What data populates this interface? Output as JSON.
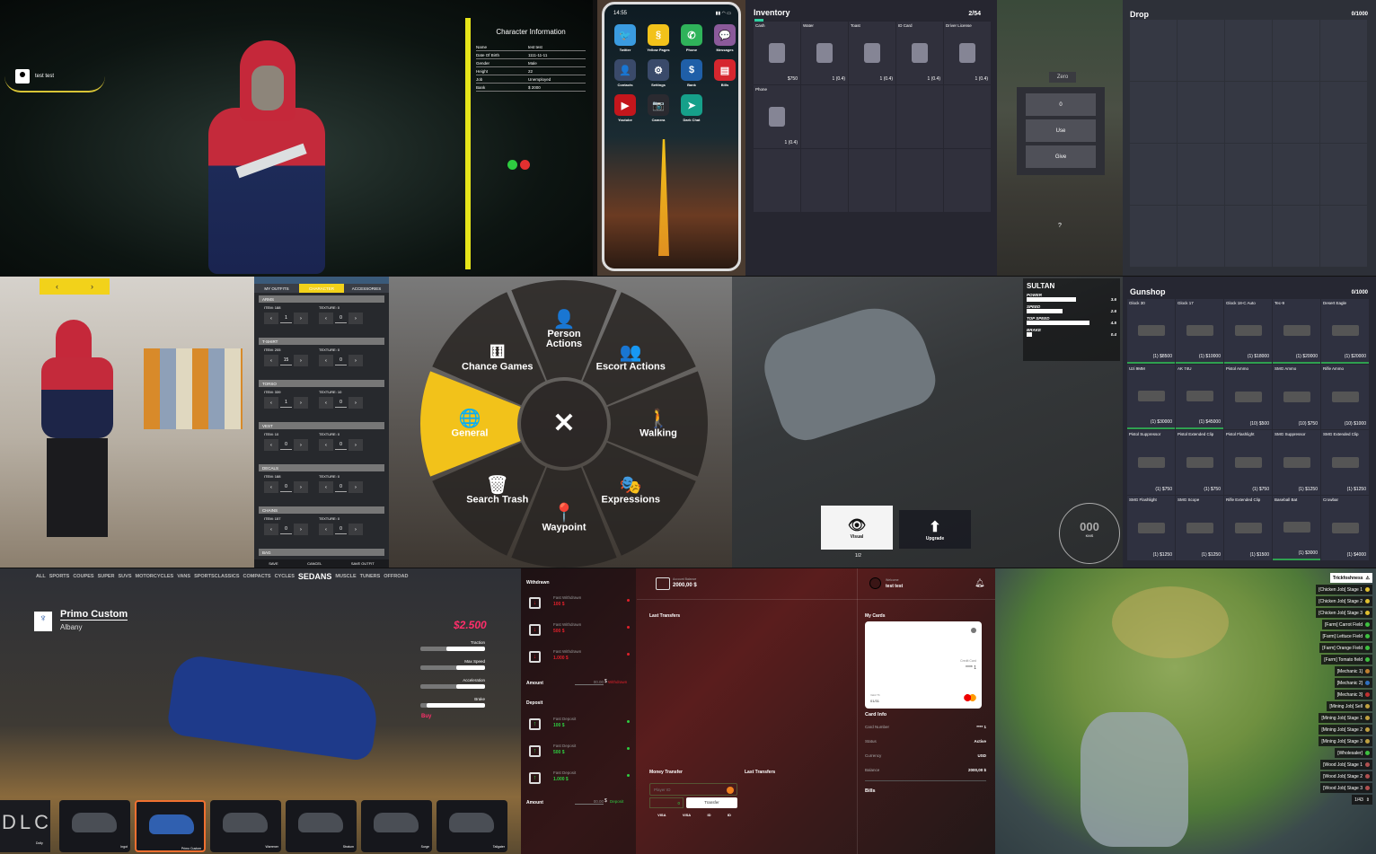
{
  "character_info": {
    "user_tag": "test test",
    "title": "Character Information",
    "rows": [
      {
        "label": "Name",
        "value": "test test"
      },
      {
        "label": "Date Of Birth",
        "value": "1111-11-11"
      },
      {
        "label": "Gender",
        "value": "Male"
      },
      {
        "label": "Height",
        "value": "22"
      },
      {
        "label": "Job",
        "value": "Unemployed"
      },
      {
        "label": "Bank",
        "value": "$ 2000"
      }
    ],
    "accent": "#e6e51a"
  },
  "phone": {
    "time": "14:55",
    "apps": [
      {
        "label": "Twitter",
        "icon": "twitter-icon",
        "color": "#3a9be0",
        "glyph": "🐦"
      },
      {
        "label": "Yellow Pages",
        "icon": "yellow-pages-icon",
        "color": "#f2c21a",
        "glyph": "§"
      },
      {
        "label": "Phone",
        "icon": "phone-icon",
        "color": "#2fb35a",
        "glyph": "✆"
      },
      {
        "label": "Messages",
        "icon": "messages-icon",
        "color": "#8a5a9a",
        "glyph": "💬"
      },
      {
        "label": "Contacts",
        "icon": "contacts-icon",
        "color": "#3a4a6a",
        "glyph": "👤"
      },
      {
        "label": "Settings",
        "icon": "settings-icon",
        "color": "#3a4a6a",
        "glyph": "⚙"
      },
      {
        "label": "Bank",
        "icon": "bank-icon",
        "color": "#1f5fa8",
        "glyph": "$"
      },
      {
        "label": "Bills",
        "icon": "bills-icon",
        "color": "#d6262e",
        "glyph": "▤"
      },
      {
        "label": "Youtube",
        "icon": "youtube-icon",
        "color": "#c4161c",
        "glyph": "▶"
      },
      {
        "label": "Camera",
        "icon": "camera-icon",
        "color": "#2a2a30",
        "glyph": "📷"
      },
      {
        "label": "Dark Chat",
        "icon": "dark-chat-icon",
        "color": "#16a08a",
        "glyph": "➤"
      }
    ]
  },
  "inventory": {
    "title": "Inventory",
    "count": "2/54",
    "items": [
      {
        "label": "Cash",
        "qty": "$750",
        "icon": "cash-icon"
      },
      {
        "label": "Water",
        "qty": "1 (0.4)",
        "icon": "water-bottle-icon"
      },
      {
        "label": "Toast",
        "qty": "1 (0.4)",
        "icon": "toast-icon"
      },
      {
        "label": "ID Card",
        "qty": "1 (0.4)",
        "icon": "id-card-icon"
      },
      {
        "label": "Driver License",
        "qty": "1 (0.4)",
        "icon": "driver-license-icon"
      },
      {
        "label": "Phone",
        "qty": "1 (0.4)",
        "icon": "phone-item-icon"
      }
    ],
    "accent": "#2fd0a0"
  },
  "item_menu": {
    "title": "Zero",
    "amount": "0",
    "use": "Use",
    "give": "Give",
    "help": "?"
  },
  "drop": {
    "title": "Drop",
    "count": "0/1000"
  },
  "clothing": {
    "tabs": [
      "MY OUTFITS",
      "CHARACTER",
      "ACCESSORIES"
    ],
    "active_tab": "CHARACTER",
    "sections": [
      {
        "name": "ARMS",
        "item_label": "ITEM: 188",
        "item_value": "1",
        "texture_label": "TEXTURE: 0",
        "texture_value": "0"
      },
      {
        "name": "T-SHIRT",
        "item_label": "ITEM: 205",
        "item_value": "15",
        "texture_label": "TEXTURE: 0",
        "texture_value": "0"
      },
      {
        "name": "TORSO",
        "item_label": "ITEM: 339",
        "item_value": "1",
        "texture_label": "TEXTURE: 10",
        "texture_value": "0"
      },
      {
        "name": "VEST",
        "item_label": "ITEM: 10",
        "item_value": "0",
        "texture_label": "TEXTURE: 0",
        "texture_value": "0"
      },
      {
        "name": "DECALS",
        "item_label": "ITEM: 188",
        "item_value": "0",
        "texture_label": "TEXTURE: 0",
        "texture_value": "0"
      },
      {
        "name": "CHAINS",
        "item_label": "ITEM: 157",
        "item_value": "0",
        "texture_label": "TEXTURE: 0",
        "texture_value": "0"
      },
      {
        "name": "BAG",
        "item_label": "ITEM: 88",
        "item_value": "0",
        "texture_label": "TEXTURE: 0",
        "texture_value": "0"
      }
    ],
    "footer": {
      "save": "SAVE",
      "cancel": "CANCEL",
      "save_outfit": "SAVE OUTFIT"
    },
    "accent": "#f2d21a"
  },
  "radial_menu": {
    "items": [
      {
        "label": "Person Actions",
        "icon": "person-icon",
        "glyph": "👤"
      },
      {
        "label": "Escort Actions",
        "icon": "escort-icon",
        "glyph": "👥"
      },
      {
        "label": "Walking",
        "icon": "walking-icon",
        "glyph": "🚶"
      },
      {
        "label": "Expressions",
        "icon": "expressions-icon",
        "glyph": "🎭"
      },
      {
        "label": "Waypoint",
        "icon": "waypoint-icon",
        "glyph": "📍"
      },
      {
        "label": "Search Trash",
        "icon": "trash-icon",
        "glyph": "🗑"
      },
      {
        "label": "General",
        "icon": "globe-icon",
        "glyph": "🌐",
        "active": true
      },
      {
        "label": "Chance Games",
        "icon": "dice-icon",
        "glyph": "⚅"
      }
    ],
    "close_glyph": "✕",
    "accent": "#f2c21a"
  },
  "vehicle_stats": {
    "name": "SULTAN",
    "stats": [
      {
        "label": "POWER",
        "value": "3.6",
        "fill": 0.55
      },
      {
        "label": "SPEED",
        "value": "2.6",
        "fill": 0.4
      },
      {
        "label": "TOP SPEED",
        "value": "4.5",
        "fill": 0.7
      },
      {
        "label": "BRAKE",
        "value": "0.4",
        "fill": 0.06
      }
    ],
    "buttons": [
      {
        "label": "Visual",
        "icon": "eye-icon"
      },
      {
        "label": "Upgrade",
        "icon": "arrow-up-icon"
      }
    ],
    "page": "1/2",
    "speed": "000",
    "speed_unit": "KMS"
  },
  "gunshop": {
    "title": "Gunshop",
    "count": "0/1000",
    "items": [
      {
        "label": "Glock 30",
        "price": "(1) $8500"
      },
      {
        "label": "Glock 17",
        "price": "(1) $10000"
      },
      {
        "label": "Glock 18-C Auto",
        "price": "(1) $18000"
      },
      {
        "label": "Tec-9",
        "price": "(1) $20000"
      },
      {
        "label": "Desert Eagle",
        "price": "(1) $20000"
      },
      {
        "label": "Uzi 9MM",
        "price": "(1) $30000"
      },
      {
        "label": "AK 74U",
        "price": "(1) $45000"
      },
      {
        "label": "Pistol Ammo",
        "price": "(10) $500"
      },
      {
        "label": "SMG Ammo",
        "price": "(10) $750"
      },
      {
        "label": "Rifle Ammo",
        "price": "(10) $1000"
      },
      {
        "label": "Pistol Suppressor",
        "price": "(1) $750"
      },
      {
        "label": "Pistol Extended Clip",
        "price": "(1) $750"
      },
      {
        "label": "Pistol Flashlight",
        "price": "(1) $750"
      },
      {
        "label": "SMG Suppressor",
        "price": "(1) $1250"
      },
      {
        "label": "SMG Extended Clip",
        "price": "(1) $1250"
      },
      {
        "label": "SMG Flashlight",
        "price": "(1) $1250"
      },
      {
        "label": "SMG Scope",
        "price": "(1) $1250"
      },
      {
        "label": "Rifle Extended Clip",
        "price": "(1) $1500"
      },
      {
        "label": "Baseball Bat",
        "price": "(1) $3000"
      },
      {
        "label": "Crowbar",
        "price": "(1) $4000"
      }
    ]
  },
  "vehicle_shop": {
    "categories": [
      "ALL",
      "SPORTS",
      "COUPES",
      "SUPER",
      "SUVS",
      "MOTORCYCLES",
      "VANS",
      "SPORTSCLASSICS",
      "COMPACTS",
      "CYCLES",
      "SEDANS",
      "MUSCLE",
      "TUNERS",
      "OFFROAD"
    ],
    "active_category": "SEDANS",
    "vehicle_name": "Primo Custom",
    "brand": "Albany",
    "price": "$2.500",
    "stats": [
      {
        "label": "Traction",
        "fill": 0.6
      },
      {
        "label": "Max Speed",
        "fill": 0.45
      },
      {
        "label": "Acceleration",
        "fill": 0.45
      },
      {
        "label": "Brake",
        "fill": 0.9
      }
    ],
    "buy": "Buy",
    "logo": "DLC",
    "cars": [
      "Dolly",
      "Ingot",
      "Primo Custom",
      "Warrener",
      "Stratum",
      "Surge",
      "Tailgater"
    ],
    "selected_car": "Primo Custom",
    "accent": "#ff2e6a"
  },
  "bank": {
    "withdrawn_title": "Withdrawn",
    "withdrawals": [
      {
        "label": "Fast Withdrawn",
        "value": "100 $"
      },
      {
        "label": "Fast Withdrawn",
        "value": "500 $"
      },
      {
        "label": "Fast Withdrawn",
        "value": "1.000 $"
      }
    ],
    "amount_label": "Amount",
    "amount_placeholder": "00.00",
    "currency": "$",
    "withdrawn_button": "Withdrawn",
    "deposit_title": "Deposit",
    "deposits": [
      {
        "label": "Fast Deposit",
        "value": "100 $"
      },
      {
        "label": "Fast Deposit",
        "value": "500 $"
      },
      {
        "label": "Fast Deposit",
        "value": "1.000 $"
      }
    ],
    "deposit_button": "Deposit",
    "balance_label": "Account Balance",
    "balance": "2000,00 $",
    "welcome": "Welcome",
    "username": "test test",
    "last_transfers": "Last Transfers",
    "money_transfer": "Money Transfer",
    "player_id_placeholder": "Player ID",
    "transfer_amount": "0",
    "transfer_button": "Transfer",
    "quick": [
      "VISA",
      "VISA",
      "ID",
      "ID"
    ],
    "my_cards": "My Cards",
    "card": {
      "type": "Credit Card",
      "number": "**** 1",
      "valid_label": "Valid Th",
      "expiry": "01/31"
    },
    "card_info_title": "Card Info",
    "card_info": [
      {
        "label": "Card Number",
        "value": "**** 1"
      },
      {
        "label": "Status",
        "value": "Active"
      },
      {
        "label": "Currency",
        "value": "USD"
      },
      {
        "label": "Balance",
        "value": "2000,00 $"
      }
    ],
    "bills": "Bills",
    "withdraw_color": "#e0202a",
    "deposit_color": "#2ecc40"
  },
  "map": {
    "header": "Trickfoshness",
    "blips": [
      {
        "label": "[Chicken Job] Stage 1",
        "color": "#e0c030"
      },
      {
        "label": "[Chicken Job] Stage 2",
        "color": "#e0c030"
      },
      {
        "label": "[Chicken Job] Stage 3",
        "color": "#e0c030"
      },
      {
        "label": "[Farm] Carrot Field",
        "color": "#3ec040"
      },
      {
        "label": "[Farm] Lettuce Field",
        "color": "#3ec040"
      },
      {
        "label": "[Farm] Orange Field",
        "color": "#3ec040"
      },
      {
        "label": "[Farm] Tomato field",
        "color": "#3ec040"
      },
      {
        "label": "[Mechanic 1]",
        "color": "#c08030"
      },
      {
        "label": "[Mechanic 2]",
        "color": "#3070c0"
      },
      {
        "label": "[Mechanic 3]",
        "color": "#c03030"
      },
      {
        "label": "[Mining Job] Sell",
        "color": "#c0a040"
      },
      {
        "label": "[Mining Job] Stage 1",
        "color": "#c0a040"
      },
      {
        "label": "[Mining Job] Stage 2",
        "color": "#c0a040"
      },
      {
        "label": "[Mining Job] Stage 3",
        "color": "#c0a040"
      },
      {
        "label": "[Wholesaler]",
        "color": "#3ec040"
      },
      {
        "label": "[Wood Job] Stage 1",
        "color": "#b05050"
      },
      {
        "label": "[Wood Job] Stage 2",
        "color": "#b05050"
      },
      {
        "label": "[Wood Job] Stage 3",
        "color": "#b05050"
      }
    ],
    "page": "1/43"
  }
}
